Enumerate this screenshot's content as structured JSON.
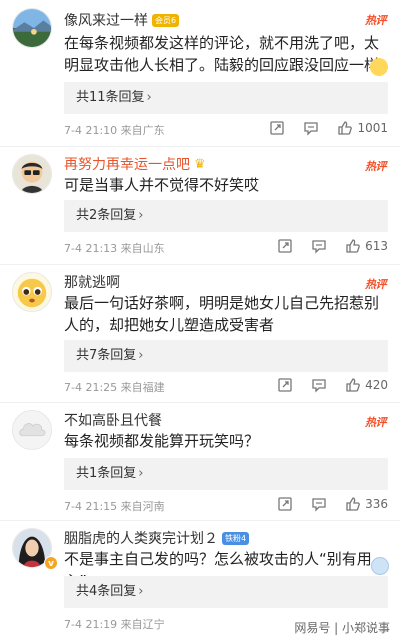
{
  "comments": [
    {
      "username": "像风来过一样",
      "badge": "会员6",
      "content": "在每条视频都发这样的评论，就不用洗了吧，太明显攻击他人长相了。陆毅的回应跟没回应一样",
      "replies": "共11条回复",
      "date": "7-4 21:10",
      "location": "来自广东",
      "likes": "1001",
      "hot": "热评"
    },
    {
      "username": "再努力再幸运一点吧",
      "content": "可是当事人并不觉得不好笑哎",
      "replies": "共2条回复",
      "date": "7-4 21:13",
      "location": "来自山东",
      "likes": "613",
      "hot": "热评"
    },
    {
      "username": "那就逃啊",
      "content": "最后一句话好茶啊，明明是她女儿自己先招惹别人的，却把她女儿塑造成受害者",
      "replies": "共7条回复",
      "date": "7-4 21:25",
      "location": "来自福建",
      "likes": "420",
      "hot": "热评"
    },
    {
      "username": "不如高卧且代餐",
      "content": "每条视频都发能算开玩笑吗？",
      "replies": "共1条回复",
      "date": "7-4 21:15",
      "location": "来自河南",
      "likes": "336",
      "hot": "热评"
    },
    {
      "username": "胭脂虎的人类爽完计划２",
      "badge": "铁粉4",
      "content": "不是事主自己发的吗？怎么被攻击的人“别有用心”",
      "replies": "共4条回复",
      "date": "7-4 21:19",
      "location": "来自辽宁"
    }
  ],
  "reply_arrow": "›",
  "watermark": "网易号 | 小郑说事"
}
